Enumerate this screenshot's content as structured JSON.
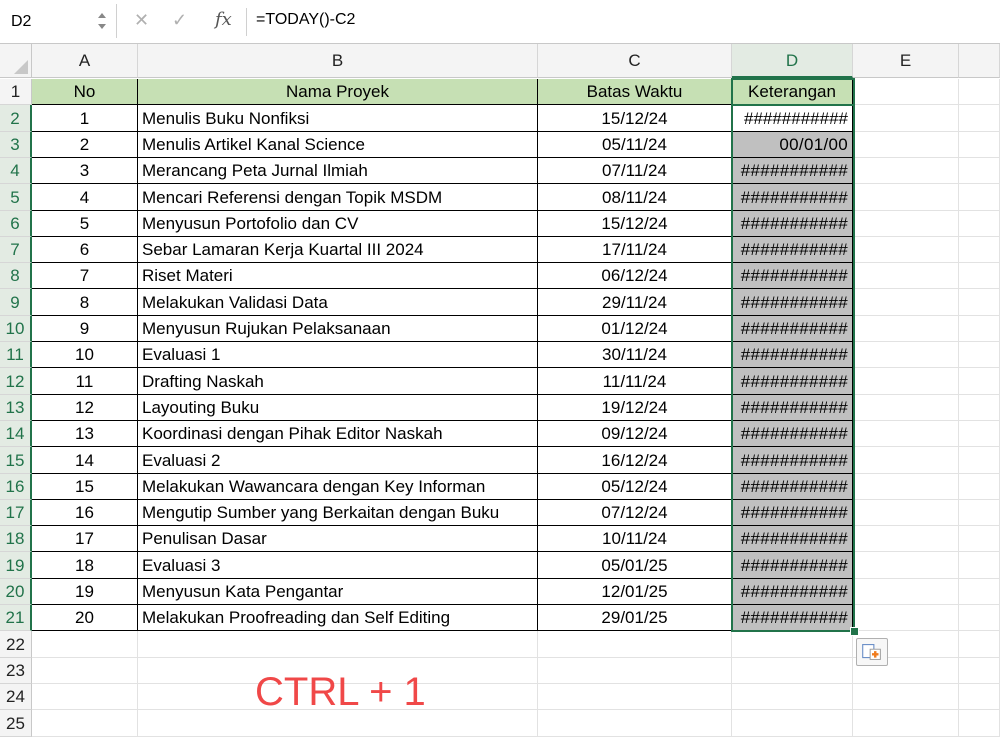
{
  "formula_bar": {
    "name_box": "D2",
    "cancel_icon": "✕",
    "enter_icon": "✓",
    "fx_label": "fx",
    "formula": "=TODAY()-C2"
  },
  "columns": [
    "A",
    "B",
    "C",
    "D",
    "E"
  ],
  "selected_column": "D",
  "row_numbers": [
    "1",
    "2",
    "3",
    "4",
    "5",
    "6",
    "7",
    "8",
    "9",
    "10",
    "11",
    "12",
    "13",
    "14",
    "15",
    "16",
    "17",
    "18",
    "19",
    "20",
    "21",
    "22",
    "23",
    "24",
    "25"
  ],
  "table": {
    "headers": [
      "No",
      "Nama Proyek",
      "Batas Waktu",
      "Keterangan"
    ],
    "rows": [
      [
        "1",
        "Menulis Buku Nonfiksi",
        "15/12/24",
        "###########"
      ],
      [
        "2",
        "Menulis Artikel Kanal Science",
        "05/11/24",
        "00/01/00"
      ],
      [
        "3",
        "Merancang Peta Jurnal Ilmiah",
        "07/11/24",
        "###########"
      ],
      [
        "4",
        "Mencari Referensi dengan Topik MSDM",
        "08/11/24",
        "###########"
      ],
      [
        "5",
        "Menyusun Portofolio dan CV",
        "15/12/24",
        "###########"
      ],
      [
        "6",
        "Sebar Lamaran Kerja Kuartal III 2024",
        "17/11/24",
        "###########"
      ],
      [
        "7",
        "Riset Materi",
        "06/12/24",
        "###########"
      ],
      [
        "8",
        "Melakukan Validasi Data",
        "29/11/24",
        "###########"
      ],
      [
        "9",
        "Menyusun Rujukan Pelaksanaan",
        "01/12/24",
        "###########"
      ],
      [
        "10",
        "Evaluasi 1",
        "30/11/24",
        "###########"
      ],
      [
        "11",
        "Drafting Naskah",
        "11/11/24",
        "###########"
      ],
      [
        "12",
        "Layouting Buku",
        "19/12/24",
        "###########"
      ],
      [
        "13",
        "Koordinasi dengan Pihak Editor Naskah",
        "09/12/24",
        "###########"
      ],
      [
        "14",
        "Evaluasi 2",
        "16/12/24",
        "###########"
      ],
      [
        "15",
        "Melakukan Wawancara dengan Key Informan",
        "05/12/24",
        "###########"
      ],
      [
        "16",
        "Mengutip Sumber yang Berkaitan dengan Buku",
        "07/12/24",
        "###########"
      ],
      [
        "17",
        "Penulisan Dasar",
        "10/11/24",
        "###########"
      ],
      [
        "18",
        "Evaluasi 3",
        "05/01/25",
        "###########"
      ],
      [
        "19",
        "Menyusun Kata Pengantar",
        "12/01/25",
        "###########"
      ],
      [
        "20",
        "Melakukan Proofreading dan Self Editing",
        "29/01/25",
        "###########"
      ]
    ]
  },
  "overlay_text": "CTRL + 1",
  "colors": {
    "header_fill": "#c6e0b4",
    "selection": "#21734a",
    "selected_fill": "#c0c0c0",
    "overlay_text": "#f04848"
  }
}
